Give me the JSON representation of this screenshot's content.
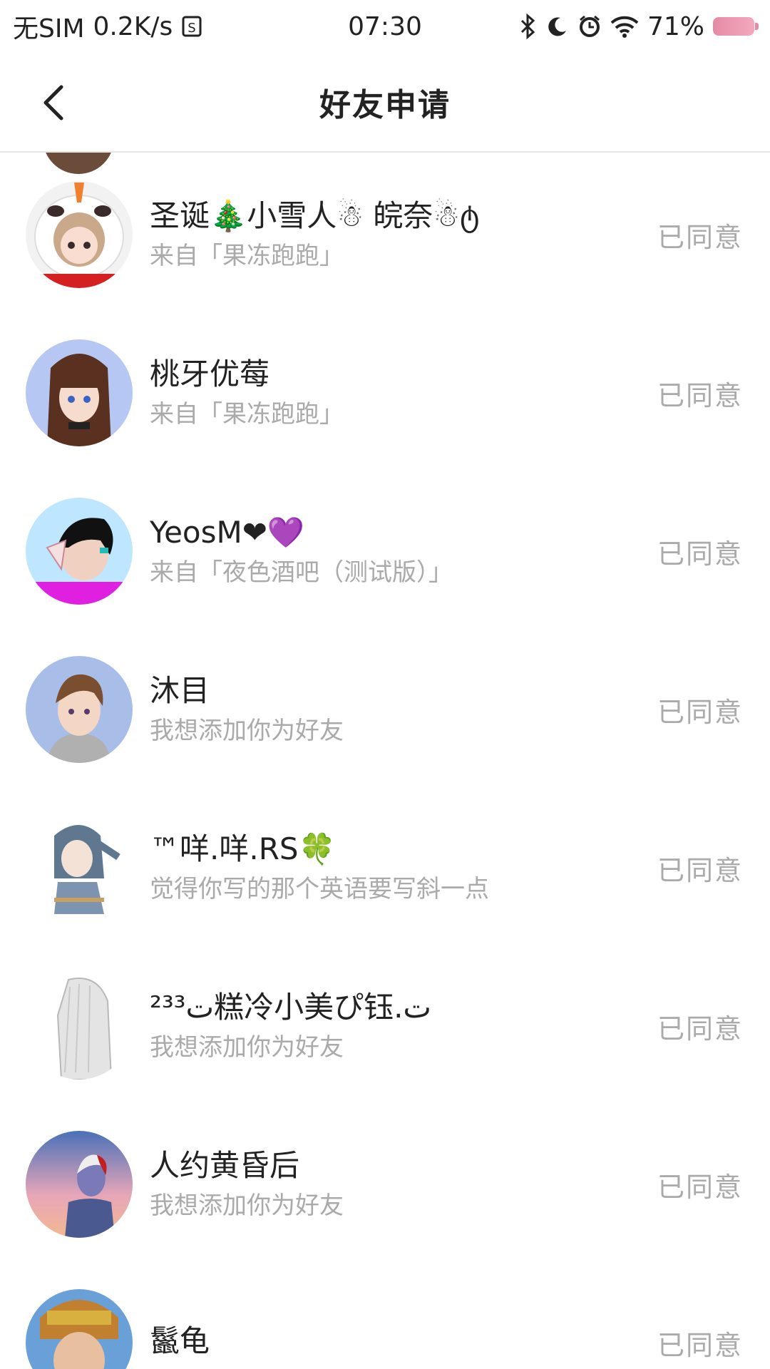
{
  "status_bar": {
    "carrier": "无SIM",
    "speed": "0.2K/s",
    "time": "07:30",
    "battery": "71%"
  },
  "nav": {
    "title": "好友申请"
  },
  "requests": [
    {
      "name": "圣诞🎄小雪人☃ 皖奈☃ტ",
      "message": "来自「果冻跑跑」",
      "status": "已同意"
    },
    {
      "name": "桃牙优莓",
      "message": "来自「果冻跑跑」",
      "status": "已同意"
    },
    {
      "name": "YeosM❤💜",
      "message": "来自「夜色酒吧（测试版）」",
      "status": "已同意"
    },
    {
      "name": "沐目",
      "message": "我想添加你为好友",
      "status": "已同意"
    },
    {
      "name": "™咩.咩.RS🍀",
      "message": "觉得你写的那个英语要写斜一点",
      "status": "已同意"
    },
    {
      "name": "ت²³³糕冷小美ぴ钰.ت",
      "message": "我想添加你为好友",
      "status": "已同意"
    },
    {
      "name": "人约黄昏后",
      "message": "我想添加你为好友",
      "status": "已同意"
    },
    {
      "name": "鬣龟",
      "message": "",
      "status": "已同意"
    }
  ],
  "colors": {
    "text_primary": "#222222",
    "text_secondary": "#aaaaaa",
    "divider": "#e6e6e6",
    "battery": "#e58aa5"
  }
}
